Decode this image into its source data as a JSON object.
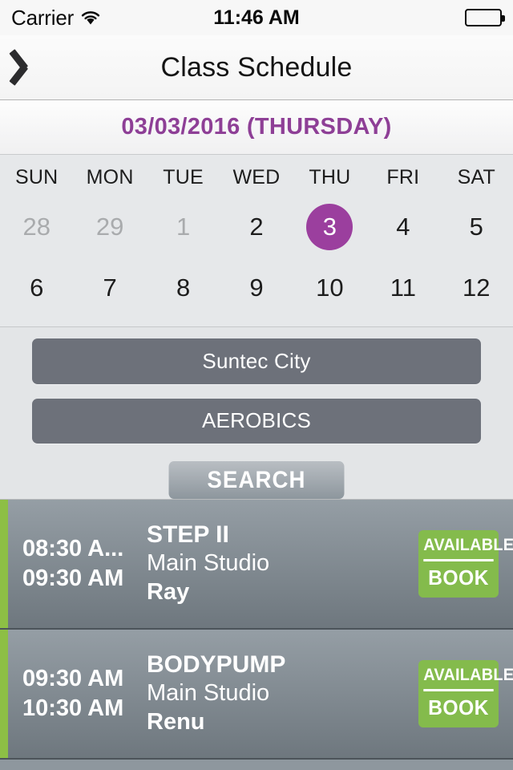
{
  "status_bar": {
    "carrier": "Carrier",
    "wifi_icon": "wifi-icon",
    "time": "11:46 AM",
    "battery_icon": "battery-full-icon"
  },
  "nav_bar": {
    "back_icon": "chevron-left-icon",
    "title": "Class Schedule"
  },
  "date_header": {
    "text": "03/03/2016 (THURSDAY)",
    "color": "#8e3f96"
  },
  "calendar": {
    "day_headers": [
      "SUN",
      "MON",
      "TUE",
      "WED",
      "THU",
      "FRI",
      "SAT"
    ],
    "selected_color": "#9b3f9e",
    "weeks": [
      [
        {
          "day": "28",
          "state": "muted"
        },
        {
          "day": "29",
          "state": "muted"
        },
        {
          "day": "1",
          "state": "muted"
        },
        {
          "day": "2",
          "state": "normal"
        },
        {
          "day": "3",
          "state": "selected"
        },
        {
          "day": "4",
          "state": "normal"
        },
        {
          "day": "5",
          "state": "normal"
        }
      ],
      [
        {
          "day": "6",
          "state": "normal"
        },
        {
          "day": "7",
          "state": "normal"
        },
        {
          "day": "8",
          "state": "normal"
        },
        {
          "day": "9",
          "state": "normal"
        },
        {
          "day": "10",
          "state": "normal"
        },
        {
          "day": "11",
          "state": "normal"
        },
        {
          "day": "12",
          "state": "normal"
        }
      ]
    ]
  },
  "filters": {
    "location_value": "Suntec City",
    "class_type_value": "AEROBICS",
    "search_label": "SEARCH"
  },
  "classes": [
    {
      "start_time": "08:30 A...",
      "end_time": "09:30 AM",
      "name": "STEP II",
      "studio": "Main Studio",
      "instructor": "Ray",
      "status_label": "AVAILABLE",
      "action_label": "BOOK",
      "status_color": "#84bb4c",
      "accent_color": "#8dbf45"
    },
    {
      "start_time": "09:30 AM",
      "end_time": "10:30 AM",
      "name": "BODYPUMP",
      "studio": "Main Studio",
      "instructor": "Renu",
      "status_label": "AVAILABLE",
      "action_label": "BOOK",
      "status_color": "#84bb4c",
      "accent_color": "#8dbf45"
    }
  ]
}
